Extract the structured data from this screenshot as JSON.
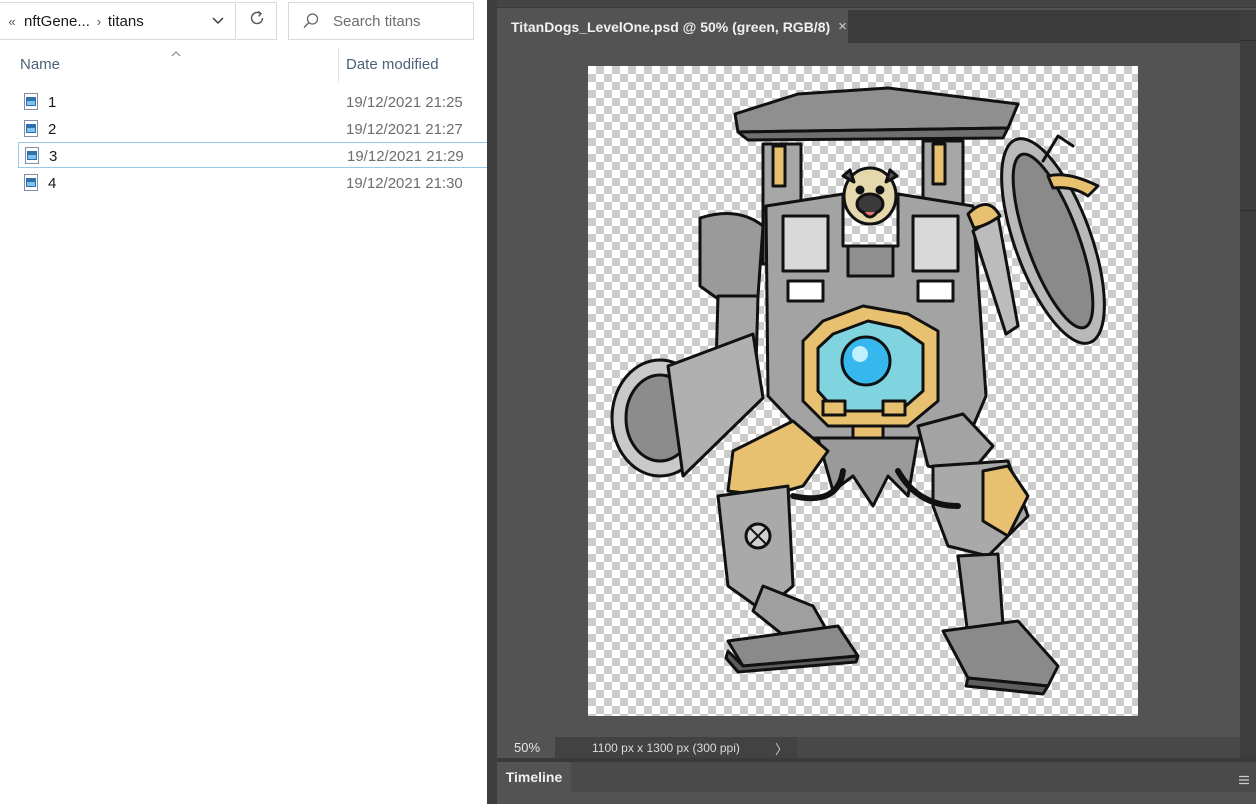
{
  "explorer": {
    "breadcrumb": {
      "back_glyph": "«",
      "parent": "nftGene...",
      "separator": "›",
      "current": "titans"
    },
    "search": {
      "placeholder": "Search titans"
    },
    "columns": {
      "name": "Name",
      "date": "Date modified"
    },
    "files": [
      {
        "name": "1",
        "date": "19/12/2021 21:25",
        "selected": false
      },
      {
        "name": "2",
        "date": "19/12/2021 21:27",
        "selected": false
      },
      {
        "name": "3",
        "date": "19/12/2021 21:29",
        "selected": true
      },
      {
        "name": "4",
        "date": "19/12/2021 21:30",
        "selected": false
      }
    ],
    "selection_color": "#99c9e8"
  },
  "photoshop": {
    "tab": {
      "title": "TitanDogs_LevelOne.psd @ 50% (green, RGB/8)",
      "close_glyph": "×"
    },
    "status": {
      "zoom": "50%",
      "doc_info": "1100 px x 1300 px (300 ppi)",
      "arrow": "〉"
    },
    "timeline": {
      "label": "Timeline"
    },
    "icons": [
      "close-icon",
      "panel-menu-icon"
    ],
    "colors": {
      "panel": "#535353",
      "dark": "#3b3b3b",
      "canvas_checker": "#cccccc"
    }
  }
}
